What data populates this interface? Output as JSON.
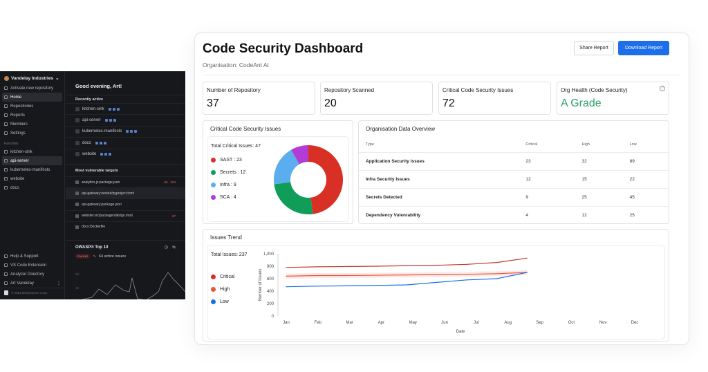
{
  "dark_app": {
    "org": "Vandelay Industries",
    "nav": [
      "Activate new repository",
      "Home",
      "Repositories",
      "Reports",
      "Members",
      "Settings"
    ],
    "favorites_label": "Favorites",
    "favorites": [
      "kitchen-sink",
      "api-server",
      "kubernetes-manifests",
      "website",
      "docs"
    ],
    "footer": [
      "Help & Support",
      "VS Code Extension",
      "Analyzer Directory",
      "Art Vandelay"
    ],
    "copyright": "© 2024 DeepSource Corp.",
    "greeting": "Good evening, Art!",
    "recent_label": "Recently active",
    "recent": [
      "kitchen-sink",
      "api-server",
      "kubernetes-manifests",
      "docs",
      "website"
    ],
    "vuln_label": "Most vulnerable targets",
    "vuln": [
      {
        "name": "analytics.js:package.json",
        "a": "56",
        "b": "234"
      },
      {
        "name": "api-gateway:nested/pyproject.toml",
        "a": "",
        "b": ""
      },
      {
        "name": "api-gateway:package.json",
        "a": "",
        "b": ""
      },
      {
        "name": "website:src/package/utils/go.mod",
        "a": "",
        "b": "67"
      },
      {
        "name": "docs:Dockerfile",
        "a": "",
        "b": ""
      }
    ],
    "owasp_title": "OWASP® Top 10",
    "owasp_badge": "FAILING",
    "owasp_issues": "64 active issues",
    "owasp_y": [
      "60",
      "40"
    ]
  },
  "dashboard": {
    "title": "Code Security Dashboard",
    "subtitle": "Organisation: CodeAnt AI",
    "share": "Share Report",
    "download": "Download Report",
    "stats": [
      {
        "label": "Number of Repository",
        "value": "37"
      },
      {
        "label": "Repository Scanned",
        "value": "20"
      },
      {
        "label": "Critical Code Security Issues",
        "value": "72"
      },
      {
        "label": "Org Health (Code Security)",
        "value": "A Grade"
      }
    ],
    "critical_panel": {
      "title": "Critical Code Security Issues",
      "total": "Total Critical Issues: 47",
      "legend": [
        {
          "label": "SAST : 23",
          "color": "#d93025",
          "value": 23
        },
        {
          "label": "Secrets : 12",
          "color": "#0f9d58",
          "value": 12
        },
        {
          "label": "Infra : 9",
          "color": "#5aaef0",
          "value": 9
        },
        {
          "label": "SCA : 4",
          "color": "#b23cd6",
          "value": 4
        }
      ]
    },
    "overview": {
      "title": "Organisation Data Overview",
      "headers": [
        "Type",
        "Critical",
        "High",
        "Low"
      ],
      "rows": [
        [
          "Application Security Issues",
          "23",
          "32",
          "89"
        ],
        [
          "Infra Security Issues",
          "12",
          "15",
          "22"
        ],
        [
          "Secrets Detected",
          "9",
          "25",
          "45"
        ],
        [
          "Dependency Vulenrability",
          "4",
          "12",
          "25"
        ]
      ]
    },
    "trend": {
      "title": "Issues Trend",
      "total": "Total Issues: 237",
      "legend": [
        {
          "label": "Critical",
          "color": "#d93025"
        },
        {
          "label": "High",
          "color": "#e8553d"
        },
        {
          "label": "Low",
          "color": "#1c6fe8"
        }
      ]
    }
  },
  "chart_data": [
    {
      "type": "pie",
      "title": "Critical Code Security Issues",
      "categories": [
        "SAST",
        "Secrets",
        "Infra",
        "SCA"
      ],
      "values": [
        23,
        12,
        9,
        4
      ],
      "colors": [
        "#d93025",
        "#0f9d58",
        "#5aaef0",
        "#b23cd6"
      ]
    },
    {
      "type": "line",
      "title": "Issues Trend",
      "xlabel": "Date",
      "ylabel": "Number of Issues",
      "ylim": [
        0,
        1000
      ],
      "yticks": [
        "0",
        "200",
        "400",
        "600",
        "800",
        "1,000"
      ],
      "categories": [
        "Jan",
        "Feb",
        "Mar",
        "Apr",
        "May",
        "Jun",
        "Jul",
        "Aug",
        "Sep",
        "Oct",
        "Nov",
        "Dec"
      ],
      "series": [
        {
          "name": "Critical",
          "color": "#c0392b",
          "values": [
            780,
            790,
            795,
            800,
            808,
            815,
            830,
            860,
            930
          ]
        },
        {
          "name": "High",
          "color": "#e8553d",
          "values": [
            640,
            650,
            650,
            655,
            660,
            665,
            670,
            680,
            700
          ]
        },
        {
          "name": "Low",
          "color": "#1c6fe8",
          "values": [
            470,
            480,
            485,
            490,
            500,
            540,
            580,
            600,
            700
          ]
        }
      ]
    }
  ]
}
